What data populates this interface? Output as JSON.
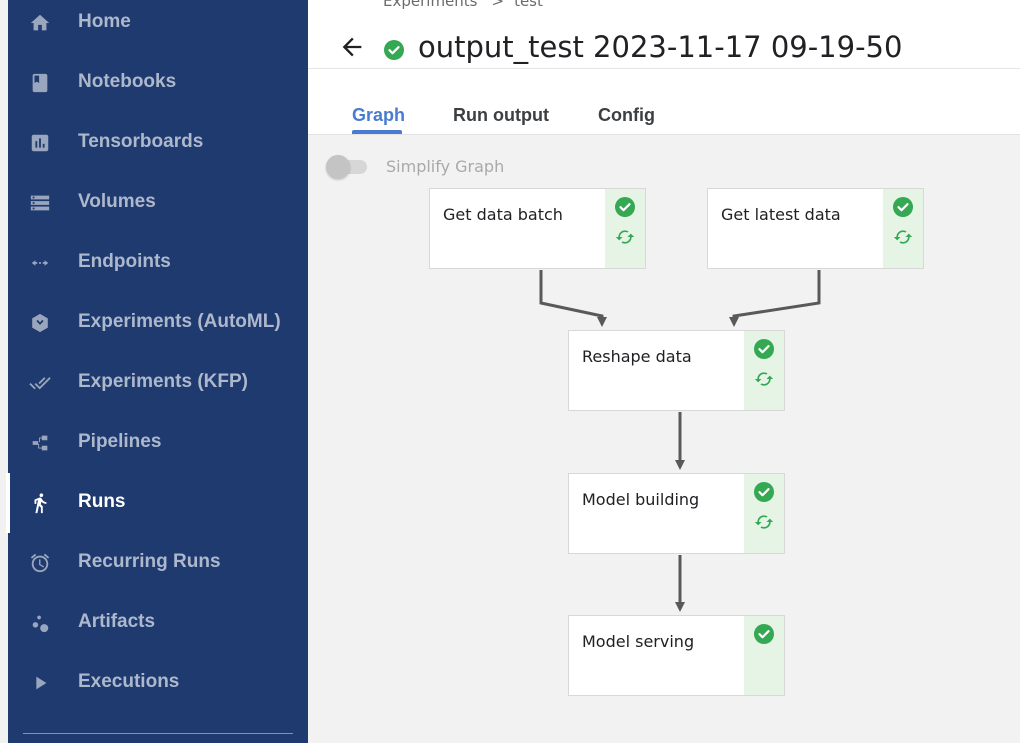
{
  "sidebar": {
    "items": [
      {
        "label": "Home",
        "icon": "home-icon",
        "active": false
      },
      {
        "label": "Notebooks",
        "icon": "notebook-icon",
        "active": false
      },
      {
        "label": "Tensorboards",
        "icon": "chart-icon",
        "active": false
      },
      {
        "label": "Volumes",
        "icon": "storage-icon",
        "active": false
      },
      {
        "label": "Endpoints",
        "icon": "code-arrows-icon",
        "active": false
      },
      {
        "label": "Experiments (AutoML)",
        "icon": "automl-icon",
        "active": false
      },
      {
        "label": "Experiments (KFP)",
        "icon": "double-check-icon",
        "active": false
      },
      {
        "label": "Pipelines",
        "icon": "pipeline-icon",
        "active": false
      },
      {
        "label": "Runs",
        "icon": "running-person-icon",
        "active": true
      },
      {
        "label": "Recurring Runs",
        "icon": "alarm-clock-icon",
        "active": false
      },
      {
        "label": "Artifacts",
        "icon": "bubbles-icon",
        "active": false
      },
      {
        "label": "Executions",
        "icon": "play-arrow-icon",
        "active": false
      }
    ]
  },
  "header": {
    "breadcrumb": [
      "Experiments",
      "test"
    ],
    "breadcrumb_separator": ">",
    "title": "output_test 2023-11-17 09-19-50",
    "status": "succeeded"
  },
  "tabs": [
    {
      "label": "Graph",
      "active": true
    },
    {
      "label": "Run output",
      "active": false
    },
    {
      "label": "Config",
      "active": false
    }
  ],
  "graph": {
    "simplify_label": "Simplify Graph",
    "simplify_enabled": false,
    "nodes": [
      {
        "label": "Get data batch",
        "status": "succeeded",
        "cached": true
      },
      {
        "label": "Get latest data",
        "status": "succeeded",
        "cached": true
      },
      {
        "label": "Reshape data",
        "status": "succeeded",
        "cached": true
      },
      {
        "label": "Model building",
        "status": "succeeded",
        "cached": true
      },
      {
        "label": "Model serving",
        "status": "succeeded",
        "cached": false
      }
    ]
  },
  "colors": {
    "sidebar_bg": "#1f3a6e",
    "accent": "#4a7bd0",
    "success": "#34a853",
    "status_bg": "#e6f4e6"
  }
}
